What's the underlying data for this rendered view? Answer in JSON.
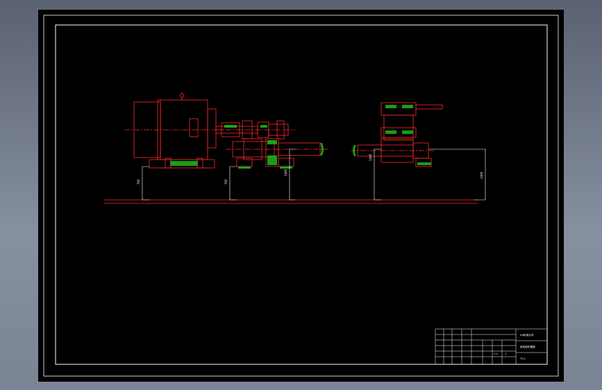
{
  "drawing": {
    "dimension_labels": [
      {
        "name": "motor-base-height",
        "text": "700"
      },
      {
        "name": "left-bearing-height",
        "text": "700"
      },
      {
        "name": "shaft-center-height-left",
        "text": "1400"
      },
      {
        "name": "shaft-center-height-right",
        "text": "1400"
      },
      {
        "name": "right-support-height",
        "text": "1400"
      }
    ],
    "title_block": {
      "company": "XX机械大学",
      "drawing_title": "某机组布置图",
      "drawing_number": "TX-1",
      "scale": "1:1",
      "sheet": "1"
    },
    "colors": {
      "line": "#ff2a2a",
      "hatch": "#1fd11f",
      "dim": "#ffffff",
      "frame": "#ffffff"
    }
  }
}
